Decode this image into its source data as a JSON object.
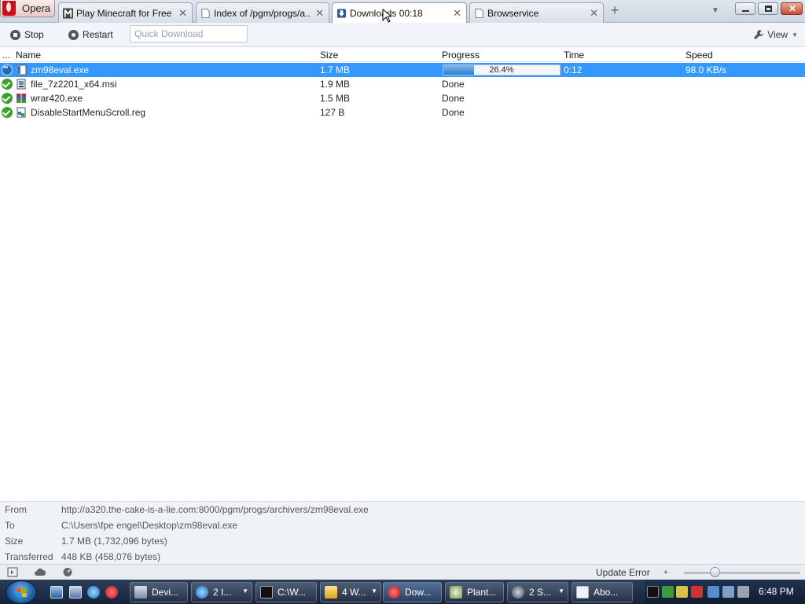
{
  "browser": {
    "menu_label": "Opera",
    "tabs": [
      {
        "title": "Play Minecraft for Free ...",
        "icon": "minecraft-icon",
        "active": false
      },
      {
        "title": "Index of /pgm/progs/a...",
        "icon": "page-icon",
        "active": false
      },
      {
        "title": "Downloads 00:18",
        "icon": "download-icon",
        "active": true
      },
      {
        "title": "Browservice",
        "icon": "page-icon",
        "active": false
      }
    ]
  },
  "toolbar": {
    "stop_label": "Stop",
    "restart_label": "Restart",
    "quick_download_placeholder": "Quick Download",
    "view_label": "View"
  },
  "table": {
    "headers": {
      "options": "...",
      "name": "Name",
      "size": "Size",
      "progress": "Progress",
      "time": "Time",
      "speed": "Speed"
    },
    "rows": [
      {
        "name": "zm98eval.exe",
        "size": "1.7 MB",
        "progress": "26.4%",
        "progress_fraction": 0.264,
        "time": "0:12",
        "speed": "98.0 KB/s",
        "status": "downloading",
        "selected": true
      },
      {
        "name": "file_7z2201_x64.msi",
        "size": "1.9 MB",
        "progress": "Done",
        "time": "",
        "speed": "",
        "status": "done",
        "selected": false
      },
      {
        "name": "wrar420.exe",
        "size": "1.5 MB",
        "progress": "Done",
        "time": "",
        "speed": "",
        "status": "done",
        "selected": false
      },
      {
        "name": "DisableStartMenuScroll.reg",
        "size": "127 B",
        "progress": "Done",
        "time": "",
        "speed": "",
        "status": "done",
        "selected": false
      }
    ]
  },
  "details": {
    "from_label": "From",
    "from_value": "http://a320.the-cake-is-a-lie.com:8000/pgm/progs/archivers/zm98eval.exe",
    "to_label": "To",
    "to_value": "C:\\Users\\fpe engel\\Desktop\\zm98eval.exe",
    "size_label": "Size",
    "size_value": "1.7 MB (1,732,096 bytes)",
    "transferred_label": "Transferred",
    "transferred_value": "448 KB (458,076 bytes)"
  },
  "statusbar": {
    "update_text": "Update Error"
  },
  "taskbar": {
    "tasks": [
      {
        "label": "Devi...",
        "icon": "device-manager-icon",
        "active": false,
        "arrow": false
      },
      {
        "label": "2 I...",
        "icon": "internet-explorer-icon",
        "active": false,
        "arrow": true
      },
      {
        "label": "C:\\W...",
        "icon": "console-icon",
        "active": false,
        "arrow": false
      },
      {
        "label": "4 W...",
        "icon": "folder-icon",
        "active": false,
        "arrow": true
      },
      {
        "label": "Dow...",
        "icon": "opera-icon",
        "active": true,
        "arrow": false
      },
      {
        "label": "Plant...",
        "icon": "plant-icon",
        "active": false,
        "arrow": false
      },
      {
        "label": "2 S...",
        "icon": "steam-icon",
        "active": false,
        "arrow": true
      },
      {
        "label": "Abo...",
        "icon": "window-icon",
        "active": false,
        "arrow": false
      }
    ],
    "clock": "6:48 PM"
  },
  "colors": {
    "selection": "#3399ff",
    "done_check": "#3ca12b",
    "progress_fill": "#2e7fd0",
    "taskbar": "#1c2c45"
  }
}
